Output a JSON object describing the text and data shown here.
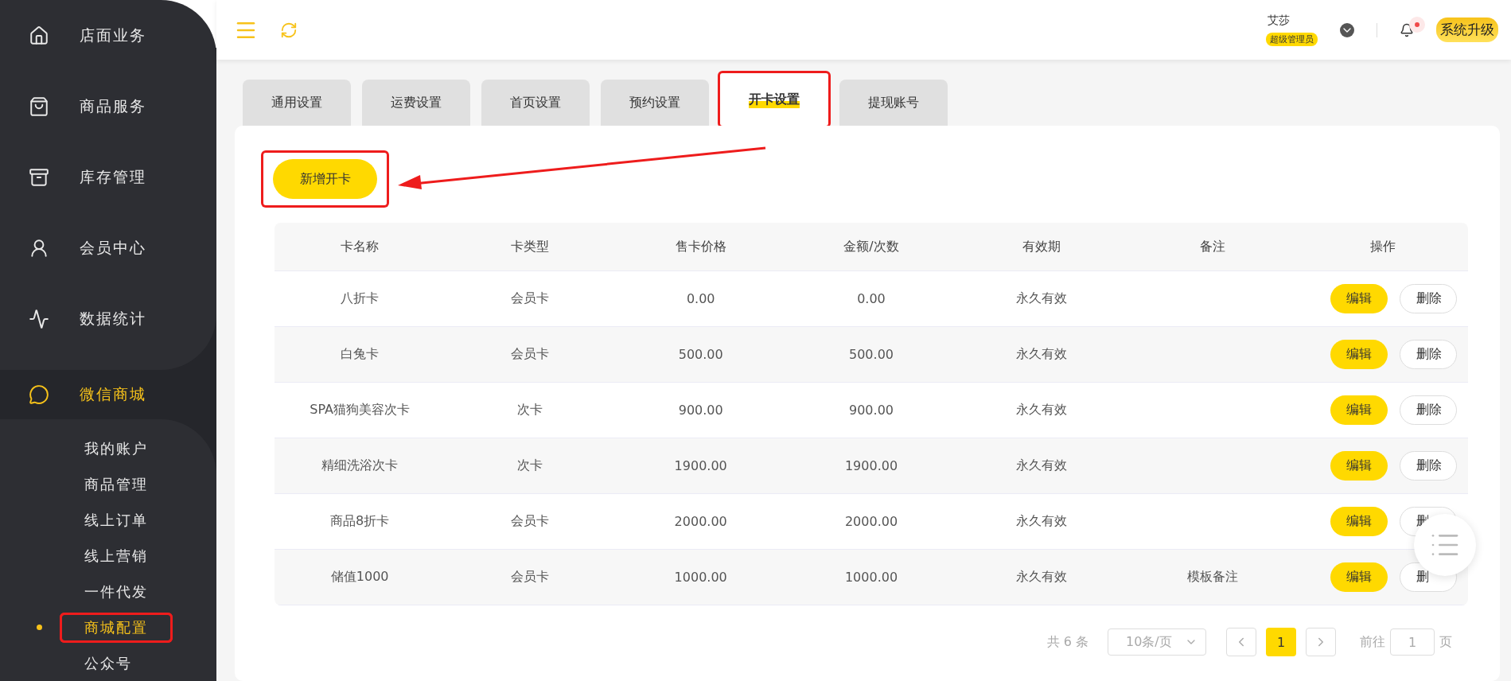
{
  "sidebar": {
    "items": [
      {
        "label": "店面业务",
        "selected": false
      },
      {
        "label": "商品服务",
        "selected": false
      },
      {
        "label": "库存管理",
        "selected": false
      },
      {
        "label": "会员中心",
        "selected": false
      },
      {
        "label": "数据统计",
        "selected": false
      },
      {
        "label": "微信商城",
        "selected": true,
        "expanded": true,
        "children": [
          {
            "label": "我的账户",
            "selected": false,
            "annotated": false
          },
          {
            "label": "商品管理",
            "selected": false,
            "annotated": false
          },
          {
            "label": "线上订单",
            "selected": false,
            "annotated": false
          },
          {
            "label": "线上营销",
            "selected": false,
            "annotated": false
          },
          {
            "label": "一件代发",
            "selected": false,
            "annotated": false
          },
          {
            "label": "商城配置",
            "selected": true,
            "annotated": true
          },
          {
            "label": "公众号",
            "selected": false,
            "annotated": false
          }
        ]
      }
    ]
  },
  "header": {
    "user_name": "艾莎",
    "user_role": "超级管理员",
    "notification_unread": true,
    "upgrade_button": "系统升级"
  },
  "tabs": [
    {
      "label": "通用设置",
      "selected": false,
      "annotated": false
    },
    {
      "label": "运费设置",
      "selected": false,
      "annotated": false
    },
    {
      "label": "首页设置",
      "selected": false,
      "annotated": false
    },
    {
      "label": "预约设置",
      "selected": false,
      "annotated": false
    },
    {
      "label": "开卡设置",
      "selected": true,
      "annotated": true
    },
    {
      "label": "提现账号",
      "selected": false,
      "annotated": false
    }
  ],
  "add_button": {
    "label": "新增开卡",
    "annotated": true
  },
  "table": {
    "columns": [
      "卡名称",
      "卡类型",
      "售卡价格",
      "金额/次数",
      "有效期",
      "备注",
      "操作"
    ],
    "rows": [
      {
        "cells": [
          "八折卡",
          "会员卡",
          "0.00",
          "0.00",
          "永久有效",
          ""
        ],
        "actions": [
          "编辑",
          "删除"
        ]
      },
      {
        "cells": [
          "白兔卡",
          "会员卡",
          "500.00",
          "500.00",
          "永久有效",
          ""
        ],
        "actions": [
          "编辑",
          "删除"
        ]
      },
      {
        "cells": [
          "SPA猫狗美容次卡",
          "次卡",
          "900.00",
          "900.00",
          "永久有效",
          ""
        ],
        "actions": [
          "编辑",
          "删除"
        ]
      },
      {
        "cells": [
          "精细洗浴次卡",
          "次卡",
          "1900.00",
          "1900.00",
          "永久有效",
          ""
        ],
        "actions": [
          "编辑",
          "删除"
        ]
      },
      {
        "cells": [
          "商品8折卡",
          "会员卡",
          "2000.00",
          "2000.00",
          "永久有效",
          ""
        ],
        "actions": [
          "编辑",
          "删"
        ]
      },
      {
        "cells": [
          "储值1000",
          "会员卡",
          "1000.00",
          "1000.00",
          "永久有效",
          "模板备注"
        ],
        "actions": [
          "编辑",
          "删"
        ]
      }
    ]
  },
  "pagination": {
    "total": "共 6 条",
    "page_size": "10条/页",
    "pages": [
      {
        "label": "1",
        "selected": true
      }
    ],
    "goto_label": "前往",
    "goto_value": "1",
    "goto_suffix": "页"
  }
}
